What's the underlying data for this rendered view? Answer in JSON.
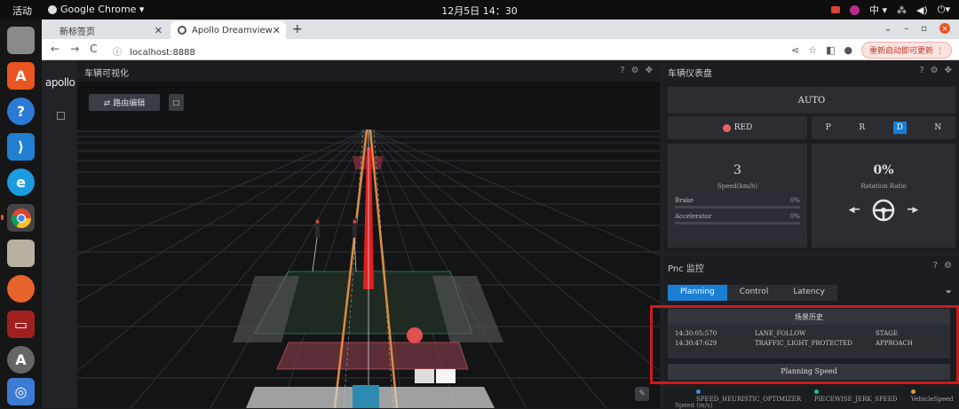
{
  "os": {
    "activities": "活动",
    "app_name": "Google Chrome ▾",
    "clock": "12月5日 14：30",
    "ime": "中 ▾"
  },
  "browser": {
    "tabs": [
      {
        "label": "新标签页"
      },
      {
        "label": "Apollo Dreamview"
      }
    ],
    "url": "localhost:8888",
    "update_button": "重新启动即可更新"
  },
  "app": {
    "logo": "apollo",
    "viz_panel": {
      "title": "车辆可视化",
      "route_button": "⇄ 路由编辑",
      "small_button": "□"
    },
    "dashboard": {
      "title": "车辆仪表盘",
      "mode": "AUTO",
      "signal": "RED",
      "signal_color": "#f06060",
      "gears": [
        "P",
        "R",
        "D",
        "N"
      ],
      "selected_gear": "D",
      "speed_value": "3",
      "speed_label": "Speed(km/h)",
      "brake_label": "Brake",
      "brake_value": "0%",
      "accel_label": "Accelerator",
      "accel_value": "0%",
      "rotation_value": "0%",
      "rotation_label": "Rotation Ratio"
    },
    "pnc": {
      "title": "Pnc 监控",
      "tabs": [
        "Planning",
        "Control",
        "Latency"
      ],
      "active_tab": "Planning",
      "scenario_history_title": "场景历史",
      "history": [
        {
          "time": "14:30:05:570",
          "scenario": "LANE_FOLLOW",
          "stage": "STAGE"
        },
        {
          "time": "14:30:47:629",
          "scenario": "TRAFFIC_LIGHT_PROTECTED",
          "stage": "APPROACH"
        }
      ],
      "planning_speed_title": "Planning Speed",
      "legend": [
        {
          "name": "SPEED_HEURISTIC_OPTIMIZER",
          "color": "#3b8fe0"
        },
        {
          "name": "PIECEWISE_JERK_SPEED",
          "color": "#22c07a"
        },
        {
          "name": "VehicleSpeed",
          "color": "#e0a030"
        }
      ],
      "y_axis_label": "Speed (m/s)"
    }
  }
}
